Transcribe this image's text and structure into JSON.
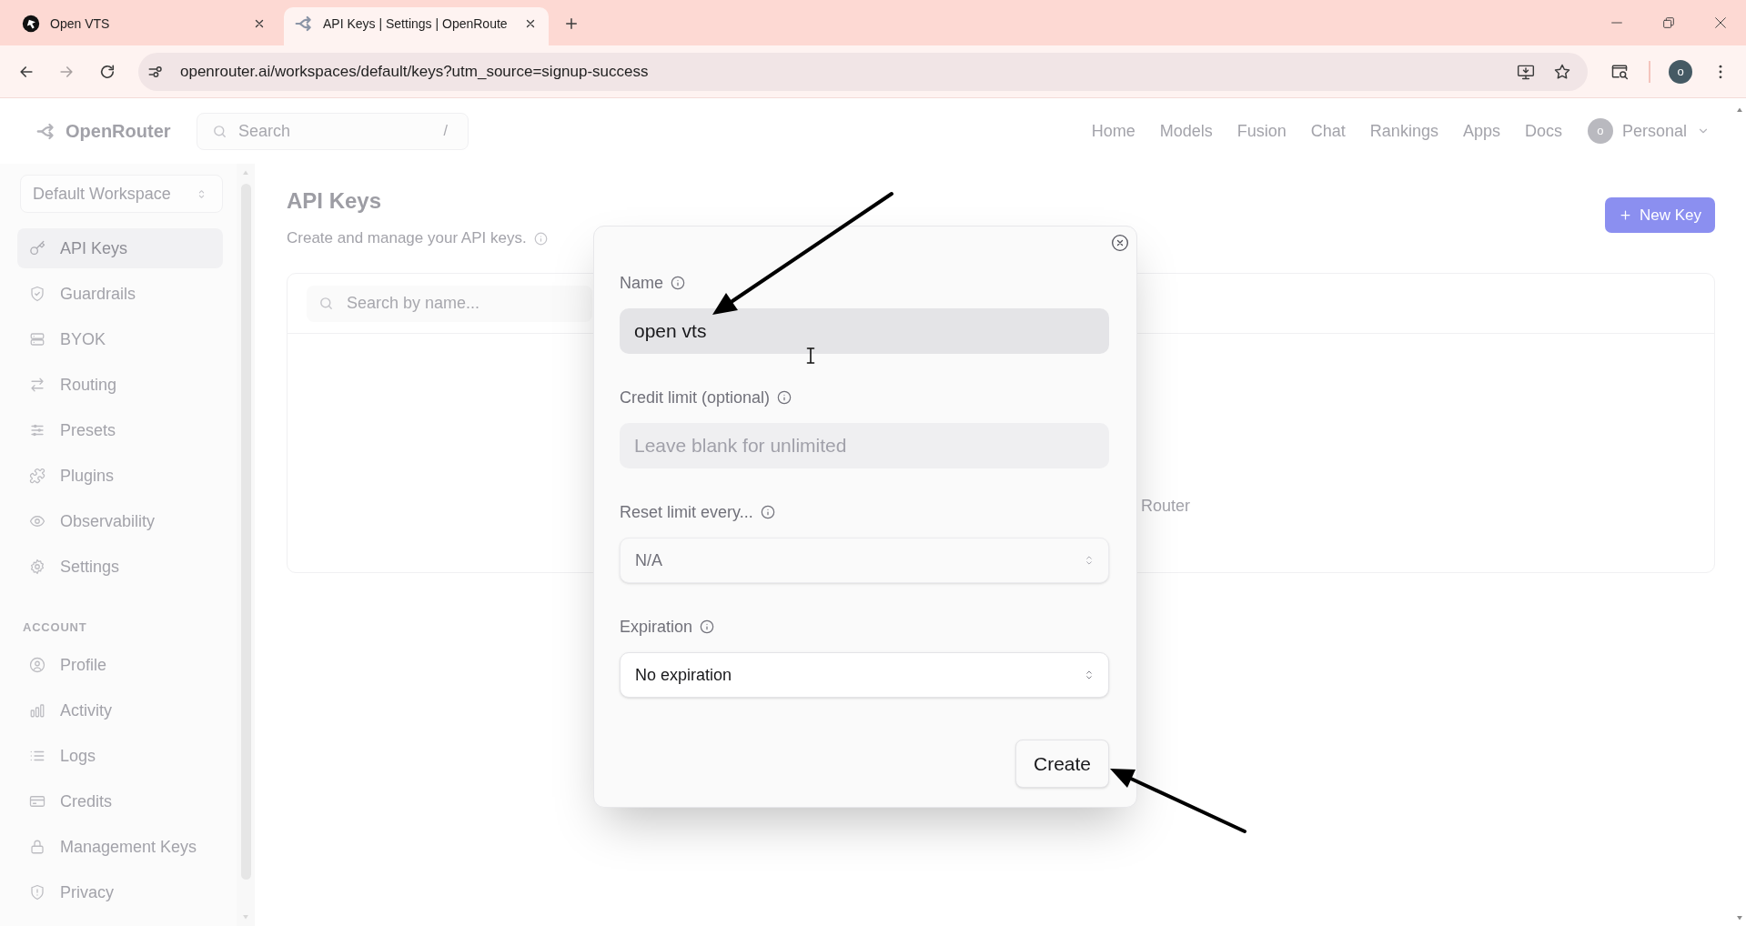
{
  "browser": {
    "tabs": [
      {
        "title": "Open VTS",
        "selected": false
      },
      {
        "title": "API Keys | Settings | OpenRoute",
        "selected": true
      }
    ],
    "url": "openrouter.ai/workspaces/default/keys?utm_source=signup-success",
    "profile_initial": "o"
  },
  "header": {
    "logo": "OpenRouter",
    "search": {
      "placeholder": "Search",
      "shortcut": "/"
    },
    "nav": [
      "Home",
      "Models",
      "Fusion",
      "Chat",
      "Rankings",
      "Apps",
      "Docs"
    ],
    "account": {
      "initial": "o",
      "label": "Personal"
    }
  },
  "sidebar": {
    "workspace": "Default Workspace",
    "sections": [
      {
        "items": [
          {
            "label": "API Keys",
            "selected": true
          },
          {
            "label": "Guardrails",
            "selected": false
          },
          {
            "label": "BYOK",
            "selected": false
          },
          {
            "label": "Routing",
            "selected": false
          },
          {
            "label": "Presets",
            "selected": false
          },
          {
            "label": "Plugins",
            "selected": false
          },
          {
            "label": "Observability",
            "selected": false
          },
          {
            "label": "Settings",
            "selected": false
          }
        ]
      },
      {
        "heading": "ACCOUNT",
        "items": [
          {
            "label": "Profile",
            "selected": false
          },
          {
            "label": "Activity",
            "selected": false
          },
          {
            "label": "Logs",
            "selected": false
          },
          {
            "label": "Credits",
            "selected": false
          },
          {
            "label": "Management Keys",
            "selected": false
          },
          {
            "label": "Privacy",
            "selected": false
          }
        ]
      }
    ]
  },
  "main": {
    "title": "API Keys",
    "subtitle": "Create and manage your API keys.",
    "new_key_button": "New Key",
    "search": {
      "placeholder": "Search by name..."
    },
    "empty_message": "Router"
  },
  "dialog": {
    "fields": [
      {
        "kind": "text",
        "label": "Name",
        "value": "open vts",
        "disabled": false
      },
      {
        "kind": "text",
        "label": "Credit limit (optional)",
        "placeholder": "Leave blank for unlimited",
        "disabled": false
      },
      {
        "kind": "select",
        "label": "Reset limit every...",
        "value": "N/A",
        "disabled": true
      },
      {
        "kind": "select",
        "label": "Expiration",
        "value": "No expiration",
        "disabled": false
      }
    ],
    "submit_button": "Create"
  }
}
